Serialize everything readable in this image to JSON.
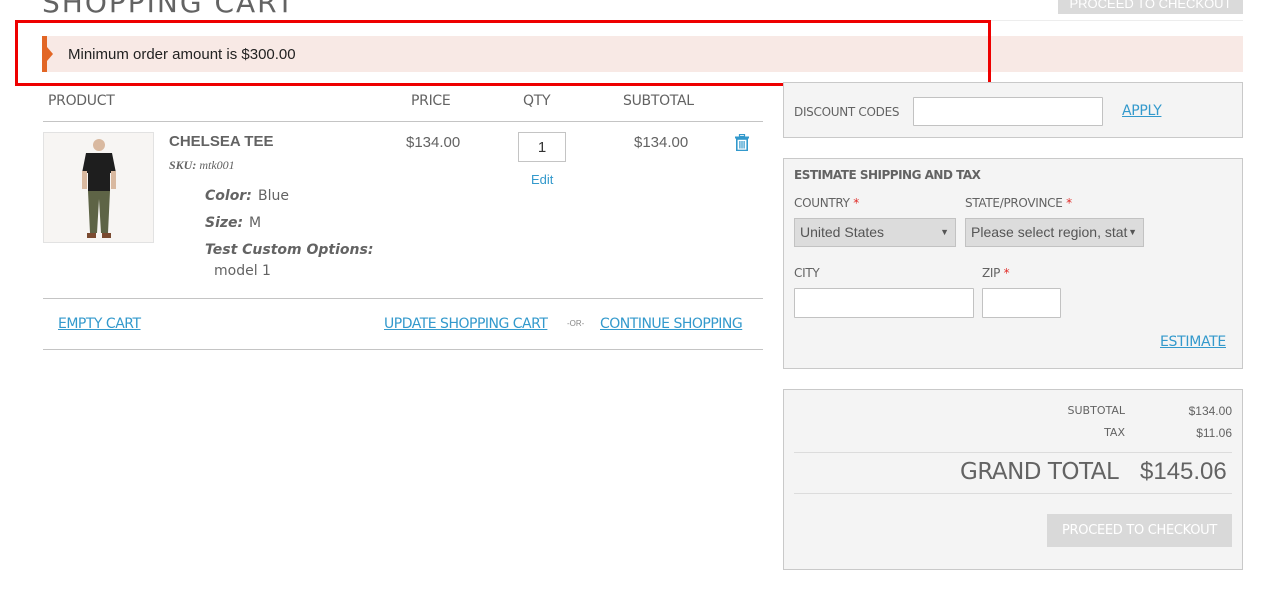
{
  "page": {
    "title": "SHOPPING CART",
    "top_checkout_label": "PROCEED TO CHECKOUT"
  },
  "message": {
    "text": "Minimum order amount is $300.00",
    "accent_color": "#e26625"
  },
  "cart": {
    "columns": [
      "PRODUCT",
      "PRICE",
      "QTY",
      "SUBTOTAL"
    ],
    "items": [
      {
        "name": "CHELSEA TEE",
        "sku_label": "SKU:",
        "sku": "mtk001",
        "options": [
          {
            "label": "Color:",
            "value": "Blue"
          },
          {
            "label": "Size:",
            "value": "M"
          },
          {
            "label": "Test Custom Options:",
            "value": "model 1"
          }
        ],
        "price": "$134.00",
        "qty": "1",
        "edit_label": "Edit",
        "subtotal": "$134.00",
        "remove_icon": "trash-icon"
      }
    ],
    "actions": {
      "empty_cart": "EMPTY CART",
      "update_cart": "UPDATE SHOPPING CART",
      "or": "-OR-",
      "continue_shopping": "CONTINUE SHOPPING"
    }
  },
  "discount": {
    "label": "DISCOUNT CODES",
    "value": "",
    "apply_label": "APPLY"
  },
  "shipping": {
    "title": "ESTIMATE SHIPPING AND TAX",
    "country_label": "COUNTRY",
    "country_value": "United States",
    "state_label": "STATE/PROVINCE",
    "state_value": "Please select region, stat",
    "city_label": "CITY",
    "city_value": "",
    "zip_label": "ZIP",
    "zip_value": "",
    "required_mark": "*",
    "estimate_label": "ESTIMATE"
  },
  "totals": {
    "subtotal_label": "SUBTOTAL",
    "subtotal_value": "$134.00",
    "tax_label": "TAX",
    "tax_value": "$11.06",
    "grand_total_label": "GRAND TOTAL",
    "grand_total_value": "$145.06",
    "checkout_label": "PROCEED TO CHECKOUT"
  },
  "colors": {
    "link": "#3399cc",
    "highlight": "#ee0000",
    "required": "#e02b27"
  }
}
